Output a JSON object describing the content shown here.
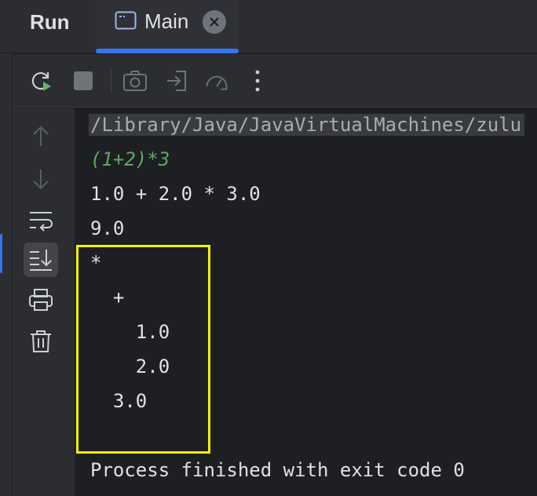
{
  "header": {
    "tool_window_title": "Run",
    "tab_label": "Main"
  },
  "toolbar": {
    "icons": [
      "rerun-icon",
      "stop-icon",
      "camera-icon",
      "attach-icon",
      "profiler-icon",
      "more-icon"
    ]
  },
  "gutter": {
    "icons": [
      "up-arrow-icon",
      "down-arrow-icon",
      "soft-wrap-icon",
      "scroll-to-end-icon",
      "print-icon",
      "trash-icon"
    ],
    "active": "scroll-to-end-icon"
  },
  "console": {
    "lines": [
      "/Library/Java/JavaVirtualMachines/zulu",
      "(1+2)*3",
      "1.0 + 2.0 * 3.0",
      "9.0",
      "*",
      "  +",
      "    1.0",
      "    2.0",
      "  3.0",
      "",
      "Process finished with exit code 0"
    ]
  },
  "colors": {
    "accent": "#3574f0",
    "highlight": "#f4f200",
    "input_text": "#5fa564"
  }
}
